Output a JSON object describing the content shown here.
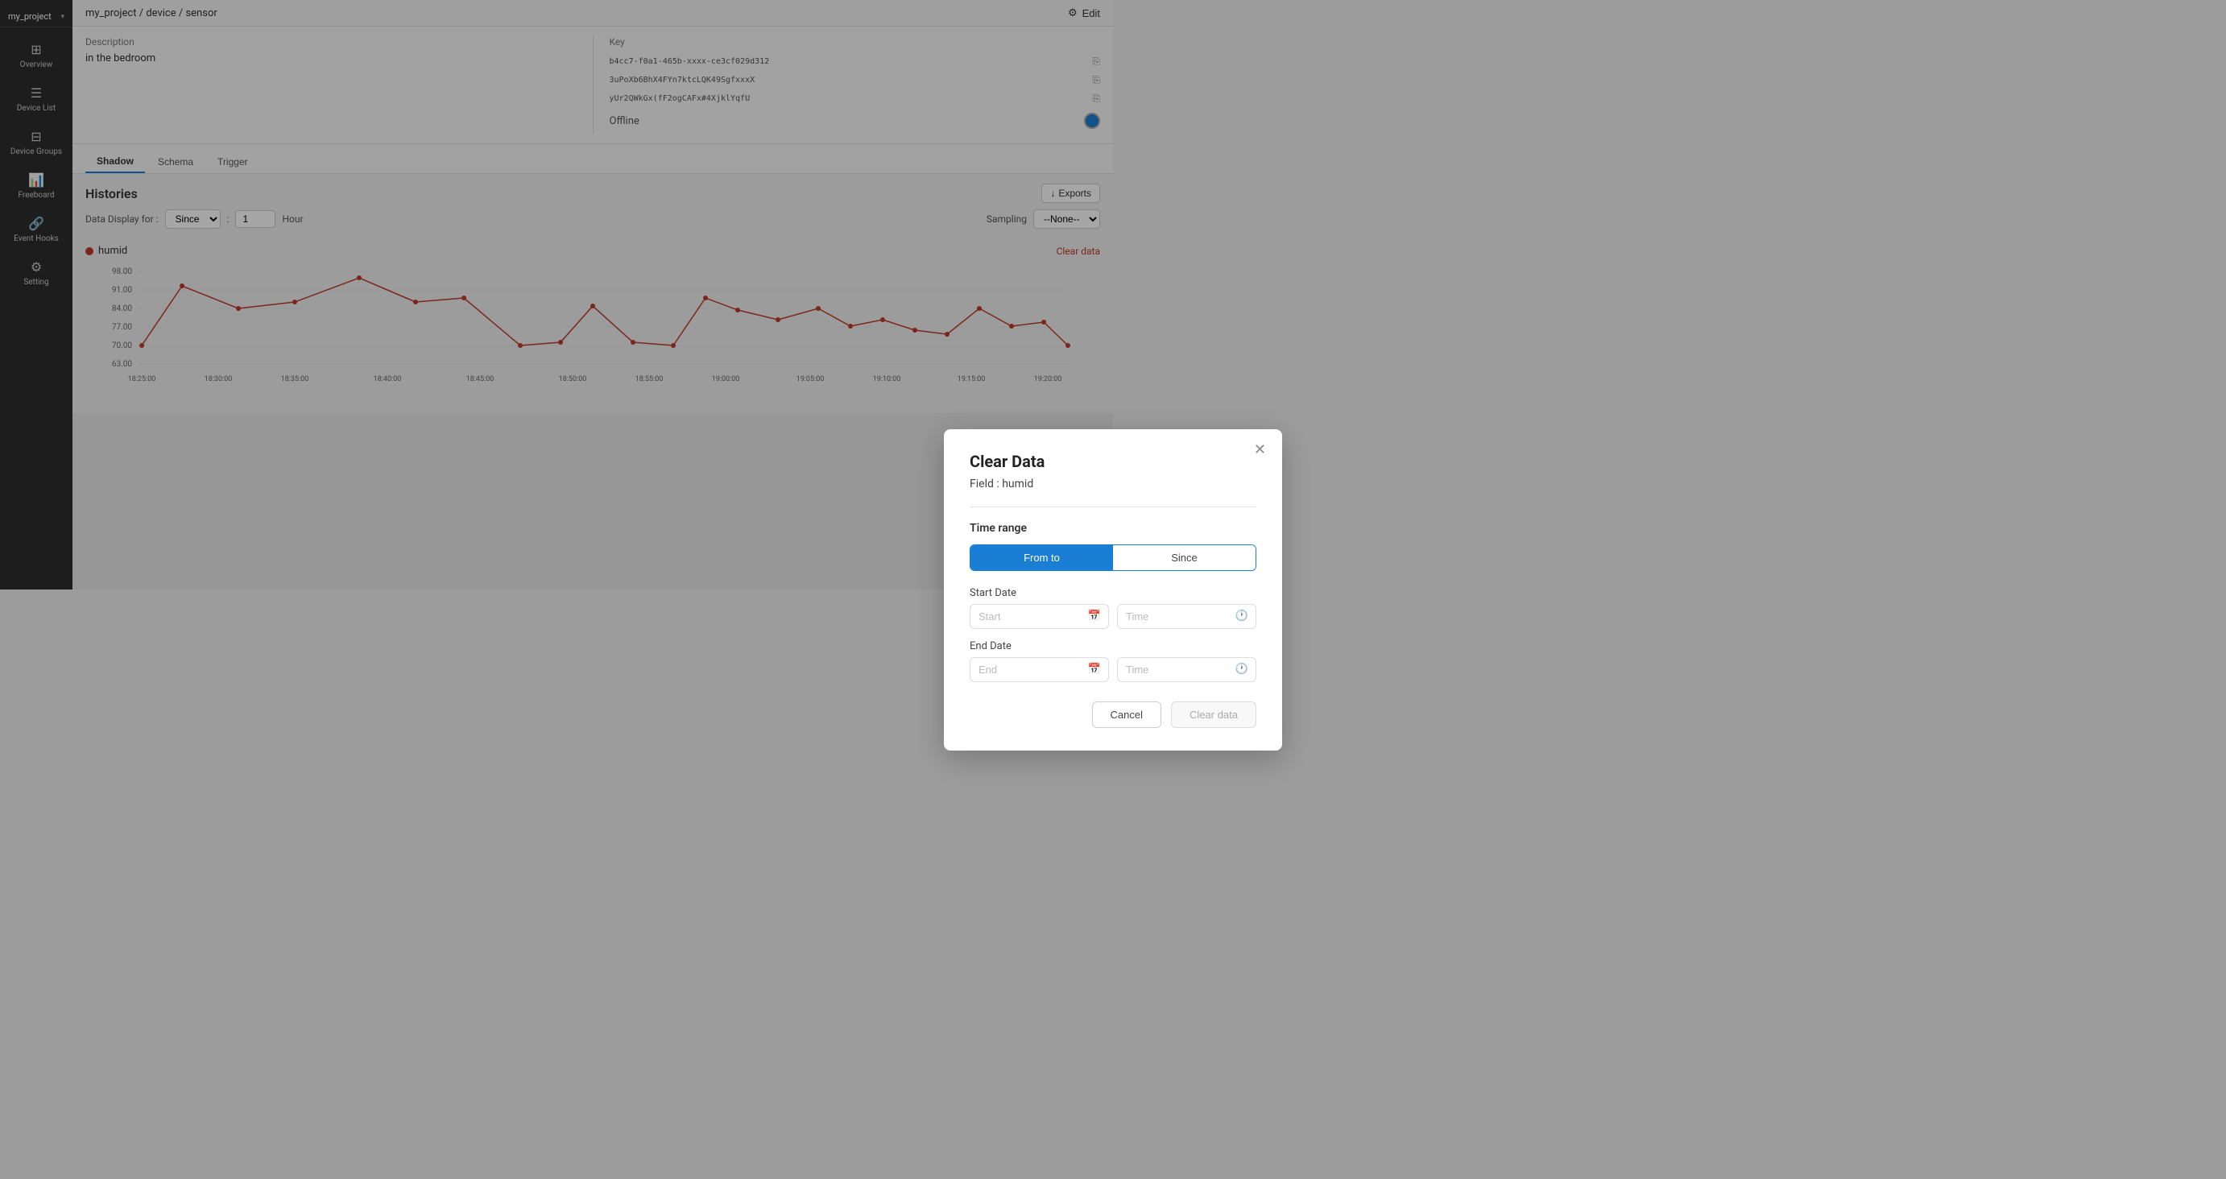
{
  "sidebar": {
    "project_name": "my_project",
    "items": [
      {
        "id": "overview",
        "label": "Overview",
        "icon": "⊞"
      },
      {
        "id": "device-list",
        "label": "Device List",
        "icon": "☰"
      },
      {
        "id": "device-groups",
        "label": "Device Groups",
        "icon": "⊟"
      },
      {
        "id": "freeboard",
        "label": "Freeboard",
        "icon": "📊"
      },
      {
        "id": "event-hooks",
        "label": "Event Hooks",
        "icon": "🔗"
      },
      {
        "id": "setting",
        "label": "Setting",
        "icon": "⚙"
      }
    ]
  },
  "breadcrumb": {
    "parts": [
      "my_project",
      "device",
      "sensor"
    ]
  },
  "edit_button": "Edit",
  "left_panel": {
    "description_label": "Description",
    "description_value": "in the bedroom"
  },
  "right_panel": {
    "key_label": "Key",
    "keys": [
      "b4cc7-f0a1-465b-xxxx-ce3cf029d312",
      "3uPoXb6BhX4FYn7ktcLQK49SgfxxxX",
      "yUr2QWkGx(fF2ogCAFx#4XjklYqfU"
    ],
    "status_label": "Offline"
  },
  "tabs": [
    "Shadow",
    "Schema",
    "Trigger"
  ],
  "histories": {
    "title": "Histories",
    "data_display_label": "Data Display for :",
    "since_option": "Since",
    "since_value": "1",
    "hour_label": "Hour",
    "exports_button": "Exports",
    "sampling_label": "Sampling",
    "sampling_value": "--None--"
  },
  "chart": {
    "legend_label": "humid",
    "clear_data_link": "Clear data",
    "y_values": [
      63.0,
      70.0,
      77.0,
      84.0,
      91.0,
      98.0
    ],
    "x_labels": [
      "18:25:00",
      "18:30:00",
      "18:35:00",
      "18:40:00",
      "18:45:00",
      "18:50:00",
      "18:55:00",
      "19:00:00",
      "19:05:00",
      "19:10:00",
      "19:15:00",
      "19:20:00"
    ]
  },
  "modal": {
    "title": "Clear Data",
    "field_label": "Field : humid",
    "time_range_label": "Time range",
    "from_to_btn": "From to",
    "since_btn": "Since",
    "active_tab": "from_to",
    "start_date_label": "Start Date",
    "start_date_placeholder": "Start",
    "start_time_placeholder": "Time",
    "end_date_label": "End Date",
    "end_date_placeholder": "End",
    "end_time_placeholder": "Time",
    "cancel_btn": "Cancel",
    "clear_data_btn": "Clear data"
  }
}
